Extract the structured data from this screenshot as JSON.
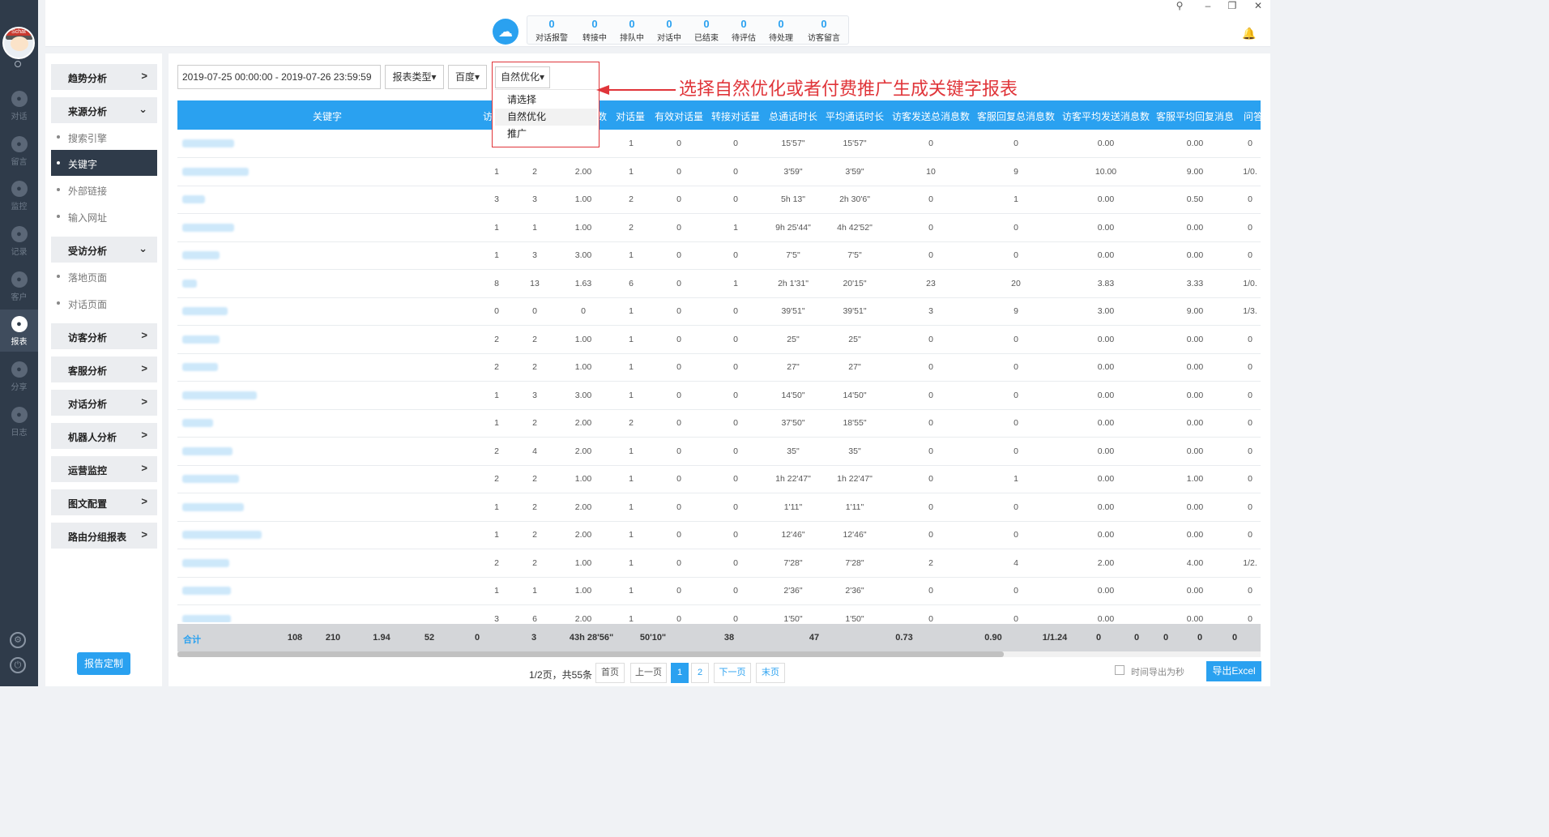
{
  "rail": {
    "avatar_hat_text": "Schat",
    "items": [
      {
        "label": "对话",
        "icon": "chat-bubble-icon"
      },
      {
        "label": "留言",
        "icon": "mail-icon"
      },
      {
        "label": "监控",
        "icon": "eye-icon"
      },
      {
        "label": "记录",
        "icon": "clock-icon"
      },
      {
        "label": "客户",
        "icon": "id-card-icon"
      },
      {
        "label": "报表",
        "icon": "pie-chart-icon"
      },
      {
        "label": "分享",
        "icon": "share-icon"
      },
      {
        "label": "日志",
        "icon": "clipboard-icon"
      }
    ]
  },
  "topbar": {
    "stats": [
      {
        "num": "0",
        "label": "对话报警"
      },
      {
        "num": "0",
        "label": "转接中"
      },
      {
        "num": "0",
        "label": "排队中"
      },
      {
        "num": "0",
        "label": "对话中"
      },
      {
        "num": "0",
        "label": "已结束"
      },
      {
        "num": "0",
        "label": "待评估"
      },
      {
        "num": "0",
        "label": "待处理"
      },
      {
        "num": "0",
        "label": "访客留言"
      }
    ]
  },
  "sidemenu": {
    "trend": "趋势分析",
    "source": "来源分析",
    "source_items": [
      "搜索引擎",
      "关键字",
      "外部链接",
      "输入网址"
    ],
    "visited": "受访分析",
    "visited_items": [
      "落地页面",
      "对话页面"
    ],
    "groups": [
      "访客分析",
      "客服分析",
      "对话分析",
      "机器人分析",
      "运营监控",
      "图文配置",
      "路由分组报表"
    ],
    "report_button": "报告定制"
  },
  "filters": {
    "date_range": "2019-07-25 00:00:00  -  2019-07-26 23:59:59",
    "report_type": "报表类型▾",
    "engine": "百度▾",
    "mode": "自然优化▾",
    "options": [
      "请选择",
      "自然优化",
      "推广"
    ]
  },
  "annotation": "选择自然优化或者付费推广生成关键字报表",
  "table": {
    "headers": [
      {
        "label": "关键字"
      },
      {
        "label": "访"
      },
      {
        "label": ""
      },
      {
        "label": "数"
      },
      {
        "label": "对话量"
      },
      {
        "label": "有效对话量"
      },
      {
        "label": "转接对话量"
      },
      {
        "label": "总通话时长"
      },
      {
        "label": "平均通话时长"
      },
      {
        "label": "访客发送总消息数"
      },
      {
        "label": "客服回复总消息数"
      },
      {
        "label": "访客平均发送消息数"
      },
      {
        "label": "客服平均回复消息"
      },
      {
        "label": "问答"
      }
    ],
    "rows": [
      [
        "",
        "",
        "",
        "1",
        "0",
        "0",
        "15'57\"",
        "15'57\"",
        "0",
        "0",
        "0.00",
        "0.00",
        "0"
      ],
      [
        "1",
        "2",
        "2.00",
        "1",
        "0",
        "0",
        "3'59\"",
        "3'59\"",
        "10",
        "9",
        "10.00",
        "9.00",
        "1/0."
      ],
      [
        "3",
        "3",
        "1.00",
        "2",
        "0",
        "0",
        "5h 13\"",
        "2h 30'6\"",
        "0",
        "1",
        "0.00",
        "0.50",
        "0"
      ],
      [
        "1",
        "1",
        "1.00",
        "2",
        "0",
        "1",
        "9h 25'44\"",
        "4h 42'52\"",
        "0",
        "0",
        "0.00",
        "0.00",
        "0"
      ],
      [
        "1",
        "3",
        "3.00",
        "1",
        "0",
        "0",
        "7'5\"",
        "7'5\"",
        "0",
        "0",
        "0.00",
        "0.00",
        "0"
      ],
      [
        "8",
        "13",
        "1.63",
        "6",
        "0",
        "1",
        "2h 1'31\"",
        "20'15\"",
        "23",
        "20",
        "3.83",
        "3.33",
        "1/0."
      ],
      [
        "0",
        "0",
        "0",
        "1",
        "0",
        "0",
        "39'51\"",
        "39'51\"",
        "3",
        "9",
        "3.00",
        "9.00",
        "1/3."
      ],
      [
        "2",
        "2",
        "1.00",
        "1",
        "0",
        "0",
        "25\"",
        "25\"",
        "0",
        "0",
        "0.00",
        "0.00",
        "0"
      ],
      [
        "2",
        "2",
        "1.00",
        "1",
        "0",
        "0",
        "27\"",
        "27\"",
        "0",
        "0",
        "0.00",
        "0.00",
        "0"
      ],
      [
        "1",
        "3",
        "3.00",
        "1",
        "0",
        "0",
        "14'50\"",
        "14'50\"",
        "0",
        "0",
        "0.00",
        "0.00",
        "0"
      ],
      [
        "1",
        "2",
        "2.00",
        "2",
        "0",
        "0",
        "37'50\"",
        "18'55\"",
        "0",
        "0",
        "0.00",
        "0.00",
        "0"
      ],
      [
        "2",
        "4",
        "2.00",
        "1",
        "0",
        "0",
        "35\"",
        "35\"",
        "0",
        "0",
        "0.00",
        "0.00",
        "0"
      ],
      [
        "2",
        "2",
        "1.00",
        "1",
        "0",
        "0",
        "1h 22'47\"",
        "1h 22'47\"",
        "0",
        "1",
        "0.00",
        "1.00",
        "0"
      ],
      [
        "1",
        "2",
        "2.00",
        "1",
        "0",
        "0",
        "1'11\"",
        "1'11\"",
        "0",
        "0",
        "0.00",
        "0.00",
        "0"
      ],
      [
        "1",
        "2",
        "2.00",
        "1",
        "0",
        "0",
        "12'46\"",
        "12'46\"",
        "0",
        "0",
        "0.00",
        "0.00",
        "0"
      ],
      [
        "2",
        "2",
        "1.00",
        "1",
        "0",
        "0",
        "7'28\"",
        "7'28\"",
        "2",
        "4",
        "2.00",
        "4.00",
        "1/2."
      ],
      [
        "1",
        "1",
        "1.00",
        "1",
        "0",
        "0",
        "2'36\"",
        "2'36\"",
        "0",
        "0",
        "0.00",
        "0.00",
        "0"
      ],
      [
        "3",
        "6",
        "2.00",
        "1",
        "0",
        "0",
        "1'50\"",
        "1'50\"",
        "0",
        "0",
        "0.00",
        "0.00",
        "0"
      ]
    ],
    "total_label": "合计",
    "total": [
      "108",
      "210",
      "1.94",
      "52",
      "0",
      "3",
      "43h 28'56\"",
      "50'10\"",
      "38",
      "47",
      "0.73",
      "0.90",
      "1/1.24",
      "0",
      "0",
      "0",
      "0",
      "0"
    ]
  },
  "pager": {
    "info": "1/2页，共55条",
    "first": "首页",
    "prev": "上一页",
    "pages": [
      "1",
      "2"
    ],
    "next": "下一页",
    "last": "末页",
    "checkbox_label": "时间导出为秒",
    "export": "导出Excel"
  },
  "colors": {
    "accent": "#2aa1f0",
    "rail": "#2f3b4a",
    "highlight": "#e0353a"
  }
}
